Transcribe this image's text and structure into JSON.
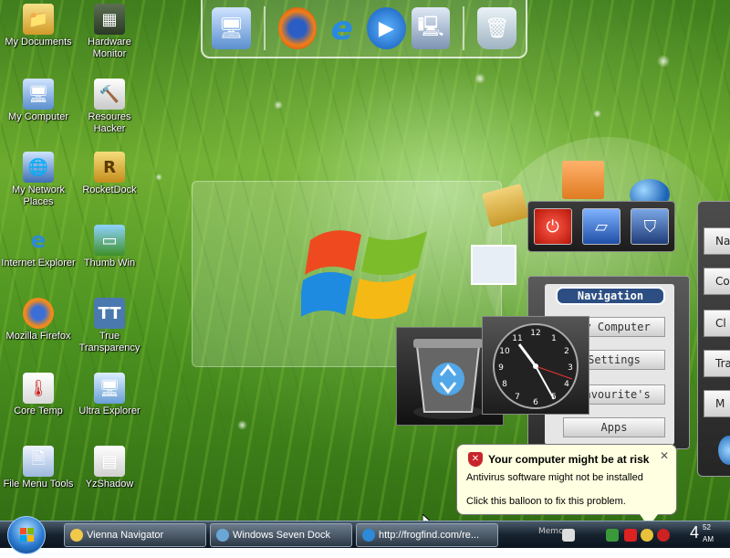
{
  "desktop_icons": [
    {
      "id": "my-documents",
      "label": "My Documents",
      "icon": "folder-icon"
    },
    {
      "id": "hardware-monitor",
      "label": "Hardware Monitor",
      "icon": "chip-icon"
    },
    {
      "id": "my-computer",
      "label": "My Computer",
      "icon": "computer-icon"
    },
    {
      "id": "resources-hacker",
      "label": "Resoures Hacker",
      "icon": "hammer-icon"
    },
    {
      "id": "my-network-places",
      "label": "My Network Places",
      "icon": "network-icon"
    },
    {
      "id": "rocketdock",
      "label": "RocketDock",
      "icon": "rocket-r-icon"
    },
    {
      "id": "internet-explorer",
      "label": "Internet Explorer",
      "icon": "ie-icon"
    },
    {
      "id": "thumbwin",
      "label": "Thumb Win",
      "icon": "thumbnail-icon"
    },
    {
      "id": "mozilla-firefox",
      "label": "Mozilla Firefox",
      "icon": "firefox-icon"
    },
    {
      "id": "true-transparency",
      "label": "True Transparency",
      "icon": "tt-icon"
    },
    {
      "id": "core-temp",
      "label": "Core Temp",
      "icon": "thermometer-icon"
    },
    {
      "id": "ultra-explorer",
      "label": "Ultra Explorer",
      "icon": "explorer-icon"
    },
    {
      "id": "file-menu-tools",
      "label": "File Menu Tools",
      "icon": "file-tools-icon"
    },
    {
      "id": "yzshadow",
      "label": "YzShadow",
      "icon": "shadow-window-icon"
    }
  ],
  "dock": {
    "items": [
      "computer-icon",
      "firefox-icon",
      "ie-icon",
      "play-icon",
      "network-drive-icon"
    ],
    "trash": "recycle-bin-icon"
  },
  "navigation_gadget": {
    "title": "Navigation",
    "buttons": [
      "My Computer",
      "Settings",
      "Favourite's",
      "Apps"
    ]
  },
  "right_panel": {
    "buttons": [
      "Nav",
      "Co",
      "Cl",
      "Tra",
      "M"
    ]
  },
  "clock_gadget": {
    "numbers": [
      "12",
      "1",
      "2",
      "3",
      "4",
      "5",
      "6",
      "7",
      "8",
      "9",
      "10",
      "11"
    ]
  },
  "balloon": {
    "title": "Your computer might be at risk",
    "line1": "Antivirus software might not be installed",
    "line2": "Click this balloon to fix this problem.",
    "close": "✕"
  },
  "taskbar": {
    "tasks": [
      {
        "label": "Vienna Navigator"
      },
      {
        "label": "Windows Seven Dock"
      },
      {
        "label": "http://frogfind.com/re..."
      }
    ],
    "memo": "Memo",
    "clock": {
      "hour": "4",
      "minute": "52",
      "ampm": "AM"
    }
  },
  "colors": {
    "accent": "#2c4e83",
    "balloon_bg": "#ffffe1",
    "danger": "#c8242b"
  }
}
